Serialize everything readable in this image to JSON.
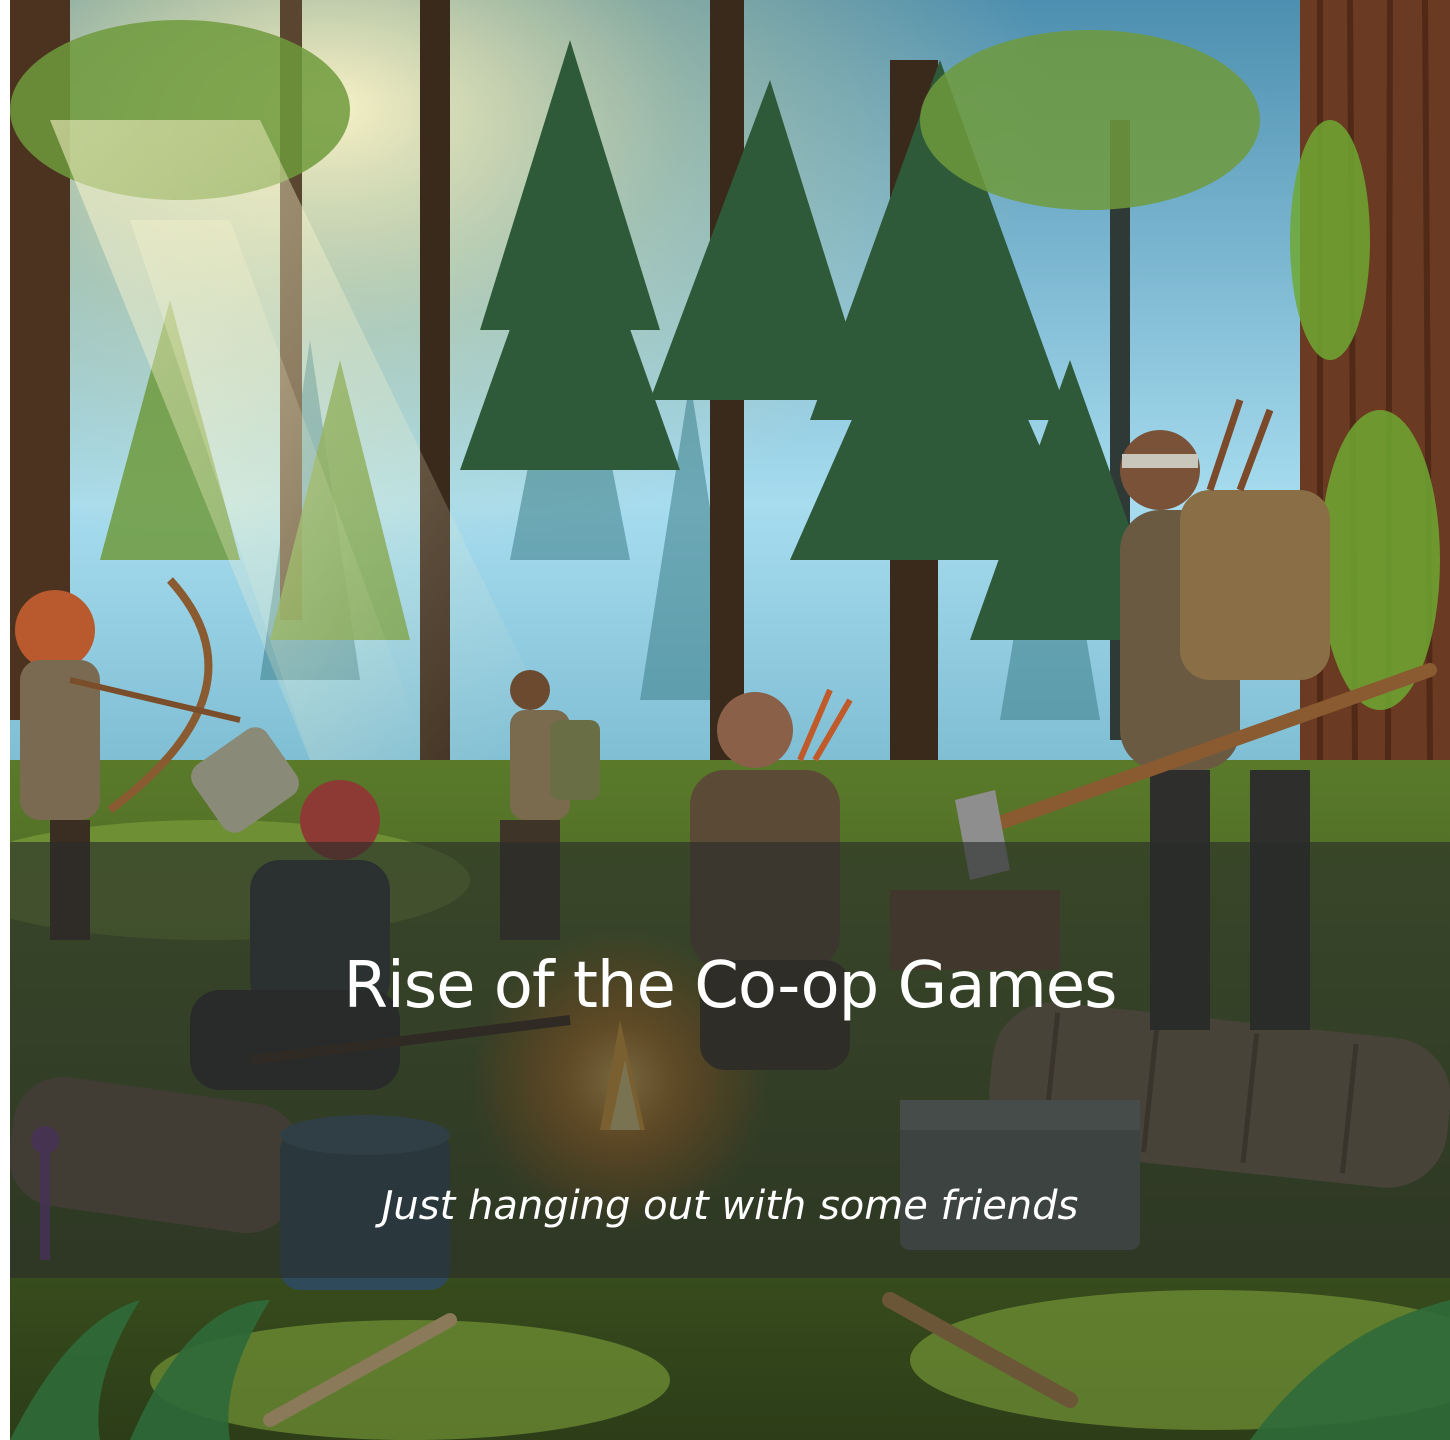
{
  "slide": {
    "title": "Rise of the Co-op Games",
    "subtitle": "Just hanging out with some friends"
  },
  "scene": {
    "description_icon": "forest-camp-illustration",
    "colors": {
      "sky": "#9fd6ee",
      "light": "#fff3b0",
      "canopy": "#2f5a3a",
      "ground": "#4f6a26",
      "fire": "#ff9a2e",
      "band": "#282c2a"
    }
  }
}
